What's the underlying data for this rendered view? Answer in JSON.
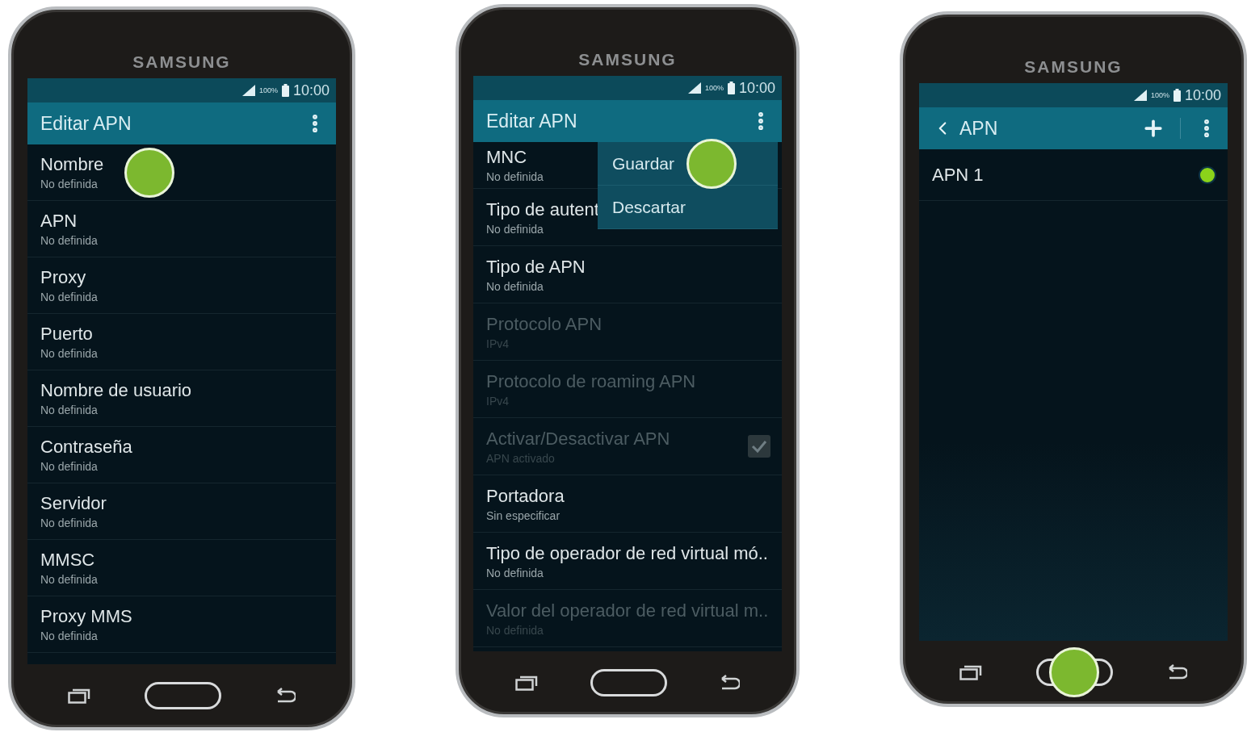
{
  "phones": [
    {
      "brand": "SAMSUNG",
      "status": {
        "battery": "100%",
        "time": "10:00"
      },
      "header": {
        "title": "Editar APN",
        "back": false,
        "add": false,
        "more": true
      },
      "home_key": {
        "tapped": false
      },
      "items": [
        {
          "kind": "text",
          "title": "Nombre",
          "subtitle": "No definida",
          "disabled": false,
          "tapped": true
        },
        {
          "kind": "text",
          "title": "APN",
          "subtitle": "No definida",
          "disabled": false,
          "tapped": false
        },
        {
          "kind": "text",
          "title": "Proxy",
          "subtitle": "No definida",
          "disabled": false,
          "tapped": false
        },
        {
          "kind": "text",
          "title": "Puerto",
          "subtitle": "No definida",
          "disabled": false,
          "tapped": false
        },
        {
          "kind": "text",
          "title": "Nombre de usuario",
          "subtitle": "No definida",
          "disabled": false,
          "tapped": false
        },
        {
          "kind": "text",
          "title": "Contraseña",
          "subtitle": "No definida",
          "disabled": false,
          "tapped": false
        },
        {
          "kind": "text",
          "title": "Servidor",
          "subtitle": "No definida",
          "disabled": false,
          "tapped": false
        },
        {
          "kind": "text",
          "title": "MMSC",
          "subtitle": "No definida",
          "disabled": false,
          "tapped": false
        },
        {
          "kind": "text",
          "title": "Proxy MMS",
          "subtitle": "No definida",
          "disabled": false,
          "tapped": false
        }
      ]
    },
    {
      "brand": "SAMSUNG",
      "status": {
        "battery": "100%",
        "time": "10:00"
      },
      "header": {
        "title": "Editar APN",
        "back": false,
        "add": false,
        "more": true
      },
      "home_key": {
        "tapped": false
      },
      "menu": [
        {
          "label": "Guardar",
          "tapped": true
        },
        {
          "label": "Descartar",
          "tapped": false
        }
      ],
      "items": [
        {
          "kind": "partial",
          "title": "MNC",
          "subtitle": "No definida",
          "disabled": false,
          "tapped": false
        },
        {
          "kind": "text",
          "title": "Tipo de autent",
          "subtitle": "No definida",
          "disabled": false,
          "tapped": false
        },
        {
          "kind": "text",
          "title": "Tipo de APN",
          "subtitle": "No definida",
          "disabled": false,
          "tapped": false
        },
        {
          "kind": "text",
          "title": "Protocolo APN",
          "subtitle": "IPv4",
          "disabled": true,
          "tapped": false
        },
        {
          "kind": "text",
          "title": "Protocolo de roaming APN",
          "subtitle": "IPv4",
          "disabled": true,
          "tapped": false
        },
        {
          "kind": "checkbox",
          "title": "Activar/Desactivar APN",
          "subtitle": "APN activado",
          "disabled": true,
          "checked": true,
          "tapped": false
        },
        {
          "kind": "text",
          "title": "Portadora",
          "subtitle": "Sin especificar",
          "disabled": false,
          "tapped": false
        },
        {
          "kind": "text",
          "title": "Tipo de operador de red virtual mó..",
          "subtitle": "No definida",
          "disabled": false,
          "tapped": false
        },
        {
          "kind": "text",
          "title": "Valor del operador de red virtual m..",
          "subtitle": "No definida",
          "disabled": true,
          "tapped": false
        }
      ]
    },
    {
      "brand": "SAMSUNG",
      "status": {
        "battery": "100%",
        "time": "10:00"
      },
      "header": {
        "title": "APN",
        "back": true,
        "add": true,
        "more": true
      },
      "home_key": {
        "tapped": true
      },
      "items": [
        {
          "kind": "radio",
          "title": "APN 1",
          "selected": true,
          "disabled": false,
          "tapped": false
        }
      ]
    }
  ]
}
